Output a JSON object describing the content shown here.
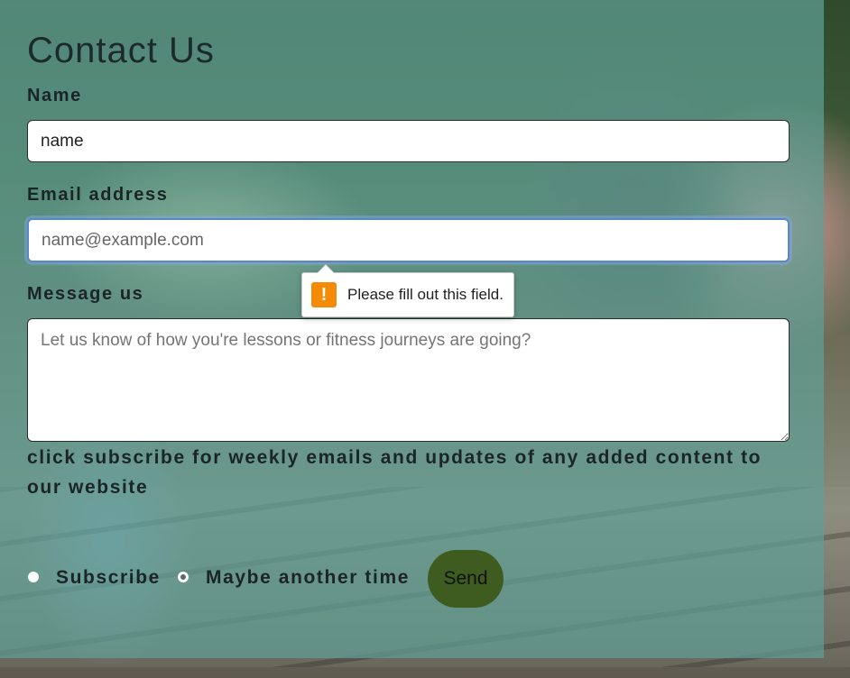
{
  "form": {
    "title": "Contact Us",
    "name_label": "Name",
    "name_value": "name",
    "email_label": "Email address",
    "email_placeholder": "name@example.com",
    "message_label": "Message us",
    "message_placeholder": "Let us know of how you're lessons or fitness journeys are going?",
    "subscribe_prompt": "click subscribe for weekly emails and updates of any added content to our website",
    "radio_subscribe": "Subscribe",
    "radio_decline": "Maybe another time",
    "send_label": "Send"
  },
  "validation": {
    "message": "Please fill out this field.",
    "icon": "warning-icon",
    "icon_glyph": "!",
    "icon_color": "#f58a07"
  },
  "colors": {
    "overlay": "#60a094",
    "send_button": "#3e5c1f",
    "focus_ring": "#5b86c8"
  }
}
